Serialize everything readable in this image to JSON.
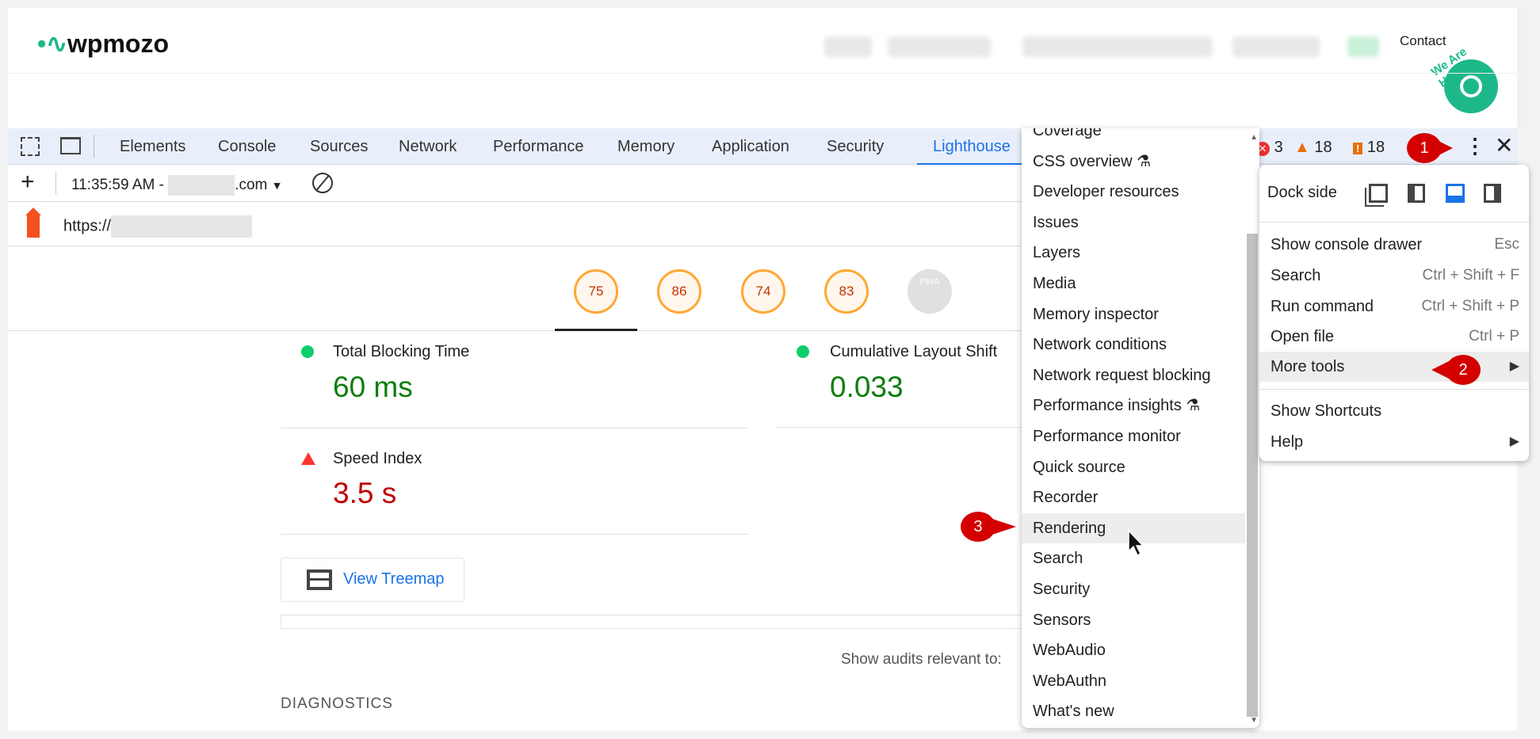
{
  "site": {
    "logo": "wpmozo",
    "contact": "Contact",
    "chat_badge": "We Are Here!"
  },
  "devtools": {
    "tabs": [
      "Elements",
      "Console",
      "Sources",
      "Network",
      "Performance",
      "Memory",
      "Application",
      "Security",
      "Lighthouse"
    ],
    "active_tab": "Lighthouse",
    "errors": "3",
    "warnings": "18",
    "issues": "18",
    "report_time": "11:35:59 AM - ",
    "report_domain": ".com",
    "url": "https://"
  },
  "lighthouse": {
    "scores": [
      {
        "value": "75"
      },
      {
        "value": "86"
      },
      {
        "value": "74"
      },
      {
        "value": "83"
      },
      {
        "value": "PWA"
      }
    ],
    "metrics": [
      {
        "label": "Total Blocking Time",
        "value": "60 ms",
        "status": "pass",
        "color": "#0c7d0c"
      },
      {
        "label": "Cumulative Layout Shift",
        "value": "0.033",
        "status": "pass",
        "color": "#0c7d0c"
      },
      {
        "label": "Speed Index",
        "value": "3.5 s",
        "status": "fail",
        "color": "#c00000"
      }
    ],
    "treemap_button": "View Treemap",
    "audits_filter": "Show audits relevant to:",
    "diagnostics": "DIAGNOSTICS"
  },
  "more_tools_menu": [
    "Coverage",
    "CSS overview",
    "Developer resources",
    "Issues",
    "Layers",
    "Media",
    "Memory inspector",
    "Network conditions",
    "Network request blocking",
    "Performance insights",
    "Performance monitor",
    "Quick source",
    "Recorder",
    "Rendering",
    "Search",
    "Security",
    "Sensors",
    "WebAudio",
    "WebAuthn",
    "What's new"
  ],
  "main_menu": {
    "dock_side": "Dock side",
    "items": [
      {
        "label": "Show console drawer",
        "shortcut": "Esc"
      },
      {
        "label": "Search",
        "shortcut": "Ctrl + Shift + F"
      },
      {
        "label": "Run command",
        "shortcut": "Ctrl + Shift + P"
      },
      {
        "label": "Open file",
        "shortcut": "Ctrl + P"
      },
      {
        "label": "More tools",
        "shortcut": ""
      }
    ],
    "items2": [
      {
        "label": "Show Shortcuts"
      },
      {
        "label": "Help"
      }
    ]
  },
  "callouts": [
    "1",
    "2",
    "3"
  ]
}
